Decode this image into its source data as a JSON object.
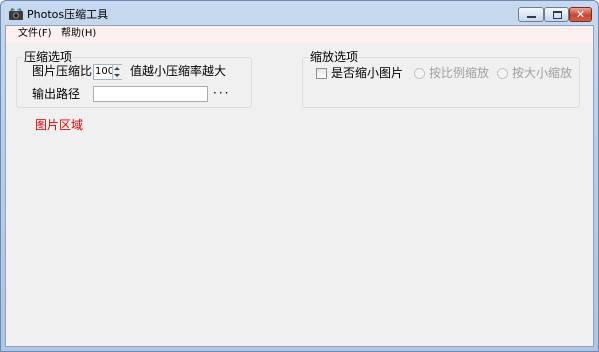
{
  "window": {
    "title": "Photos压缩工具",
    "icon": "photos-app-icon"
  },
  "menu": {
    "file": "文件(F)",
    "help": "帮助(H)"
  },
  "compress_group": {
    "title": "压缩选项",
    "ratio_label": "图片压缩比",
    "ratio_value": "100",
    "ratio_hint": "值越小压缩率越大",
    "output_label": "输出路径",
    "output_value": "",
    "browse_label": "···"
  },
  "scale_group": {
    "title": "缩放选项",
    "scale_check_label": "是否缩小图片",
    "scale_checked": false,
    "ratio_radio_label": "按比例缩放",
    "size_radio_label": "按大小缩放"
  },
  "image_area": {
    "label": "图片区域"
  },
  "colors": {
    "image_area_text": "#e60000",
    "menubar_bg": "#fdf0f0",
    "client_bg": "#f0f0f0",
    "close_button": "#c7452e"
  }
}
